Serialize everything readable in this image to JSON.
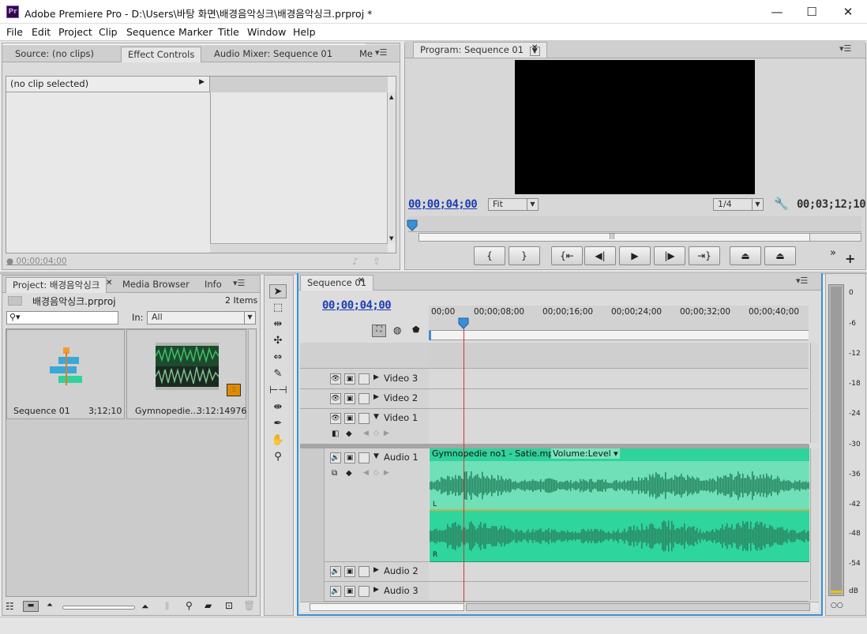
{
  "window": {
    "app_icon": "Pr",
    "title": "Adobe Premiere Pro - D:\\Users\\바탕 화면\\배경음악싱크\\배경음악싱크.prproj *",
    "minimize": "—",
    "maximize": "☐",
    "close": "✕"
  },
  "menu": [
    "File",
    "Edit",
    "Project",
    "Clip",
    "Sequence",
    "Marker",
    "Title",
    "Window",
    "Help"
  ],
  "source_panel": {
    "tabs": [
      "Source: (no clips)",
      "Effect Controls",
      "Audio Mixer: Sequence 01",
      "Me"
    ],
    "no_clip": "(no clip selected)",
    "timecode": "00;00;04;00"
  },
  "program_monitor": {
    "tab": "Program: Sequence 01",
    "current_time": "00;00;04;00",
    "zoom": "Fit",
    "resolution": "1/4",
    "duration": "00;03;12;10",
    "playhead_fraction": 0.0,
    "transport": [
      "mark-in",
      "mark-out",
      "go-to-in",
      "step-back",
      "play",
      "step-forward",
      "go-to-out",
      "lift",
      "extract"
    ]
  },
  "project_panel": {
    "tabs": [
      "Project: 배경음악싱크",
      "Media Browser",
      "Info"
    ],
    "project_file": "배경음악싱크.prproj",
    "item_count": "2 Items",
    "in_label": "In:",
    "in_value": "All",
    "items": [
      {
        "name": "Sequence 01",
        "duration": "3;12;10"
      },
      {
        "name": "Gymnopedie...",
        "duration": "3:12:14976"
      }
    ]
  },
  "timeline": {
    "tab": "Sequence 01",
    "current_time": "00;00;04;00",
    "ruler": [
      "00;00",
      "00;00;08;00",
      "00;00;16;00",
      "00;00;24;00",
      "00;00;32;00",
      "00;00;40;00"
    ],
    "tracks": {
      "video3": "Video 3",
      "video2": "Video 2",
      "video1": "Video 1",
      "audio1": "Audio 1",
      "audio2": "Audio 2",
      "audio3": "Audio 3"
    },
    "audio_clip": {
      "name": "Gymnopedie no1 - Satie.mp3",
      "property": "Volume:Level",
      "left_channel": "L",
      "right_channel": "R"
    }
  },
  "audio_meter": {
    "scale": [
      "0",
      "-6",
      "-12",
      "-18",
      "-24",
      "-30",
      "-36",
      "-42",
      "-48",
      "-54",
      "dB"
    ]
  },
  "colors": {
    "timecode_blue": "#1c3fb5",
    "audio_clip_green": "#2fd39b",
    "playhead_red": "#d9342b"
  }
}
